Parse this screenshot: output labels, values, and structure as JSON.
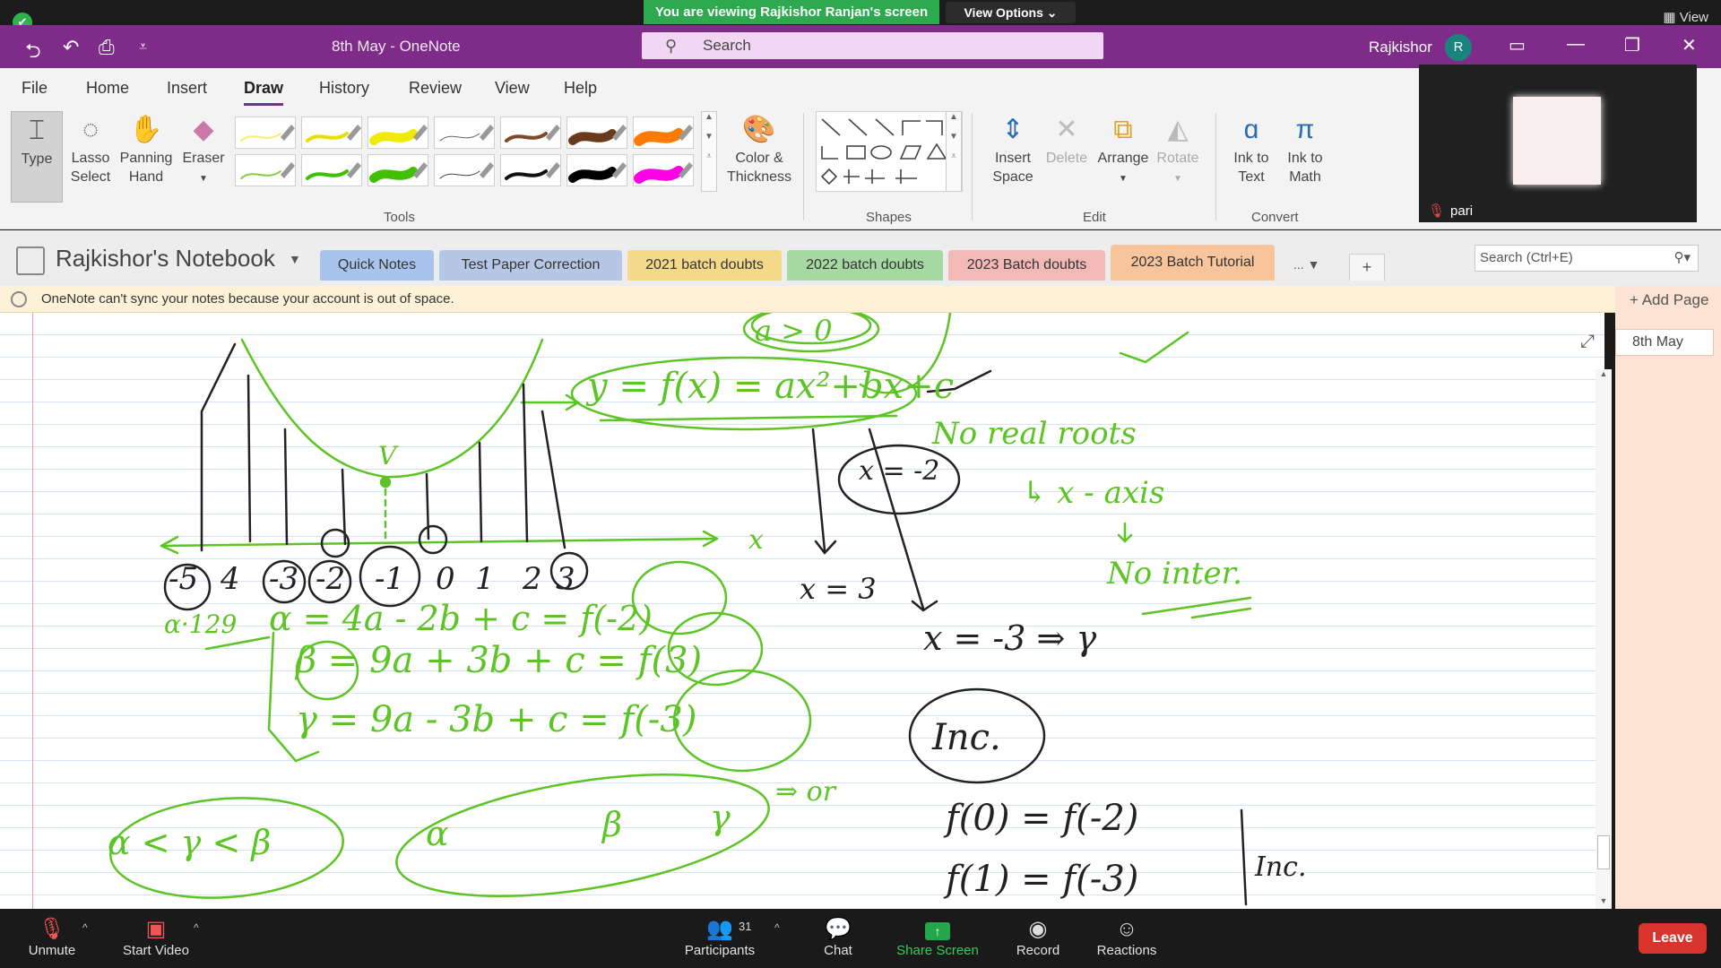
{
  "zoom": {
    "share_banner": "You are viewing Rajkishor Ranjan's screen",
    "view_options": "View Options ⌄",
    "view_label": "View",
    "video": {
      "participant_name": "pari"
    },
    "bottom": {
      "unmute": "Unmute",
      "start_video": "Start Video",
      "participants": "Participants",
      "participants_count": "31",
      "chat": "Chat",
      "share_screen": "Share Screen",
      "record": "Record",
      "reactions": "Reactions",
      "leave": "Leave"
    }
  },
  "onenote": {
    "doc_title": "8th May  -  OneNote",
    "search_placeholder": "Search",
    "user_name": "Rajkishor",
    "avatar_initial": "R",
    "menu": [
      "File",
      "Home",
      "Insert",
      "Draw",
      "History",
      "Review",
      "View",
      "Help"
    ],
    "active_menu": "Draw",
    "ribbon": {
      "type": "Type",
      "lasso": [
        "Lasso",
        "Select"
      ],
      "panning": [
        "Panning",
        "Hand"
      ],
      "eraser": "Eraser",
      "color_thickness": [
        "Color &",
        "Thickness"
      ],
      "tools_label": "Tools",
      "shapes_label": "Shapes",
      "insert_space": [
        "Insert",
        "Space"
      ],
      "delete": "Delete",
      "arrange": "Arrange",
      "rotate": "Rotate",
      "edit_label": "Edit",
      "ink_to_text": [
        "Ink to",
        "Text"
      ],
      "ink_to_math": [
        "Ink to",
        "Math"
      ],
      "convert_label": "Convert"
    },
    "pens": [
      {
        "color": "#f4f06a",
        "width": 2
      },
      {
        "color": "#e5e000",
        "width": 4
      },
      {
        "color": "#f0ea00",
        "width": 10
      },
      {
        "color": "#666666",
        "width": 1
      },
      {
        "color": "#7a4a2a",
        "width": 4
      },
      {
        "color": "#6b3a1c",
        "width": 10
      },
      {
        "color": "#ff7a00",
        "width": 12
      },
      {
        "color": "#7fd23a",
        "width": 2
      },
      {
        "color": "#3fbf00",
        "width": 4
      },
      {
        "color": "#40c000",
        "width": 10
      },
      {
        "color": "#444444",
        "width": 1
      },
      {
        "color": "#111111",
        "width": 4
      },
      {
        "color": "#000000",
        "width": 10
      },
      {
        "color": "#ff00e6",
        "width": 12
      }
    ],
    "notebook_name": "Rajkishor's Notebook",
    "sections": [
      {
        "label": "Quick Notes",
        "color": "#a9c4ec"
      },
      {
        "label": "Test Paper Correction",
        "color": "#b6c7e6"
      },
      {
        "label": "2021 batch doubts",
        "color": "#f5d98a"
      },
      {
        "label": "2022 batch doubts",
        "color": "#a6d8a1"
      },
      {
        "label": "2023 Batch doubts",
        "color": "#f3b9b7"
      },
      {
        "label": "2023 Batch Tutorial",
        "color": "#f7c49b"
      }
    ],
    "sections_more": "...",
    "search_pages_placeholder": "Search (Ctrl+E)",
    "sync_warning": "OneNote can't sync your notes because your account is out of space.",
    "add_page": "Add Page",
    "page_title": "8th May"
  },
  "ink": {
    "ink_color": "#5cc424",
    "ink_color_dark": "#222222",
    "eq_main": "y = f(x) = ax²+bx+c",
    "a_gt_0": "a > 0",
    "no_real_roots": "No real roots",
    "x_axis": "↳ x - axis",
    "no_inter": "No inter.",
    "x_eq_m2": "x = -2",
    "x_eq_3": "x = 3",
    "x_eq_m3": "x = -3 ⇒ γ",
    "axis_x": "x",
    "vertex": "V",
    "tick_labels": [
      "-5",
      "4",
      "-3",
      "-2",
      "-1",
      "0",
      "1",
      "2",
      "3"
    ],
    "a129": "α·129",
    "line_alpha": "α = 4a - 2b + c = f(-2)",
    "line_beta": "β = 9a + 3b + c = f(3)",
    "line_gamma": "γ = 9a - 3b + c = f(-3)",
    "ineq": "α < γ < β",
    "oval_a": "α",
    "oval_b": "β",
    "oval_c": "γ",
    "arrow_or": "⇒ or",
    "inc": "Inc.",
    "f0": "f(0) = f(-2)",
    "f1": "f(1) = f(-3)",
    "inc2": "Inc."
  }
}
